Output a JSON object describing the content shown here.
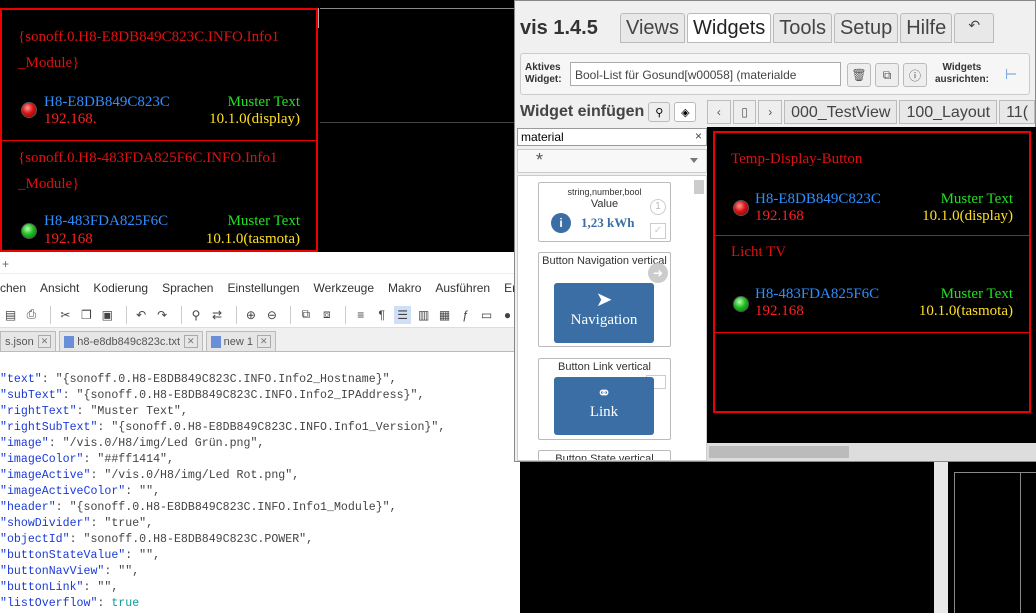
{
  "top_list": {
    "rows": [
      {
        "header": "{sonoff.0.H8-E8DB849C823C.INFO.Info1_Module}",
        "host": "H8-E8DB849C823C",
        "ip": "192.168.",
        "right_text": "Muster Text",
        "right_sub": "10.1.0(display)",
        "led": "red"
      },
      {
        "header": "{sonoff.0.H8-483FDA825F6C.INFO.Info1_Module}",
        "host": "H8-483FDA825F6C",
        "ip": "192.168",
        "right_text": "Muster Text",
        "right_sub": "10.1.0(tasmota)",
        "led": "green"
      }
    ]
  },
  "editor": {
    "title_glyph": "+",
    "menu": [
      "chen",
      "Ansicht",
      "Kodierung",
      "Sprachen",
      "Einstellungen",
      "Werkzeuge",
      "Makro",
      "Ausführen",
      "Er"
    ],
    "tabs": [
      {
        "label": "s.json"
      },
      {
        "label": "h8-e8db849c823c.txt"
      },
      {
        "label": "new 1"
      }
    ],
    "lines": [
      {
        "key": "\"text\"",
        "val": ": \"{sonoff.0.H8-E8DB849C823C.INFO.Info2_Hostname}\","
      },
      {
        "key": "\"subText\"",
        "val": ": \"{sonoff.0.H8-E8DB849C823C.INFO.Info2_IPAddress}\","
      },
      {
        "key": "\"rightText\"",
        "val": ": \"Muster Text\","
      },
      {
        "key": "\"rightSubText\"",
        "val": ": \"{sonoff.0.H8-E8DB849C823C.INFO.Info1_Version}\","
      },
      {
        "key": "\"image\"",
        "val": ": \"/vis.0/H8/img/Led Grün.png\","
      },
      {
        "key": "\"imageColor\"",
        "val": ": \"##ff1414\","
      },
      {
        "key": "\"imageActive\"",
        "val": ": \"/vis.0/H8/img/Led Rot.png\","
      },
      {
        "key": "\"imageActiveColor\"",
        "val": ": \"\","
      },
      {
        "key": "\"header\"",
        "val": ": \"{sonoff.0.H8-E8DB849C823C.INFO.Info1_Module}\","
      },
      {
        "key": "\"showDivider\"",
        "val": ": \"true\","
      },
      {
        "key": "\"objectId\"",
        "val": ": \"sonoff.0.H8-E8DB849C823C.POWER\","
      },
      {
        "key": "\"buttonStateValue\"",
        "val": ": \"\","
      },
      {
        "key": "\"buttonNavView\"",
        "val": ": \"\","
      },
      {
        "key": "\"buttonLink\"",
        "val": ": \"\","
      },
      {
        "key": "\"listOverflow\"",
        "val": ": ",
        "bool": "true"
      }
    ]
  },
  "vis": {
    "title": "vis 1.4.5",
    "tabs": [
      {
        "label": "Views"
      },
      {
        "label": "Widgets"
      },
      {
        "label": "Tools"
      },
      {
        "label": "Setup"
      },
      {
        "label": "Hilfe"
      }
    ],
    "undo_glyph": "↶",
    "active_widget_label_1": "Aktives",
    "active_widget_label_2": "Widget:",
    "active_widget_value": "Bool-List für Gosund[w00058] (materialde",
    "align_label_1": "Widgets",
    "align_label_2": "ausrichten:",
    "insert_title": "Widget einfügen",
    "search_value": "material",
    "search_clear": "×",
    "filter_value": "*",
    "widgets": {
      "value": {
        "label": "string,number,bool",
        "name": "Value",
        "value": "1,23 kWh",
        "badge": "1"
      },
      "nav": {
        "label": "Button Navigation vertical",
        "tile": "Navigation"
      },
      "link": {
        "label": "Button Link vertical",
        "tile": "Link"
      },
      "state": {
        "label": "Button State vertical"
      }
    },
    "view_tabs": [
      {
        "label": "000_TestView"
      },
      {
        "label": "100_Layout"
      },
      {
        "label": "11("
      }
    ],
    "preview": {
      "rows": [
        {
          "header": "Temp-Display-Button",
          "host": "H8-E8DB849C823C",
          "ip": "192.168",
          "right_text": "Muster Text",
          "right_sub": "10.1.0(display)",
          "led": "red"
        },
        {
          "header": "Licht TV",
          "host": "H8-483FDA825F6C",
          "ip": "192.168",
          "right_text": "Muster Text",
          "right_sub": "10.1.0(tasmota)",
          "led": "green"
        }
      ]
    }
  },
  "colors": {
    "accent_red": "#e00000",
    "host_blue": "#2f8fff",
    "ip_red": "#ff2020",
    "right_green": "#20e020",
    "sub_yellow": "#ffe020",
    "json_key": "#1a3ad8",
    "json_bool": "#0a9a9a",
    "material_blue": "#3a6ea5"
  }
}
